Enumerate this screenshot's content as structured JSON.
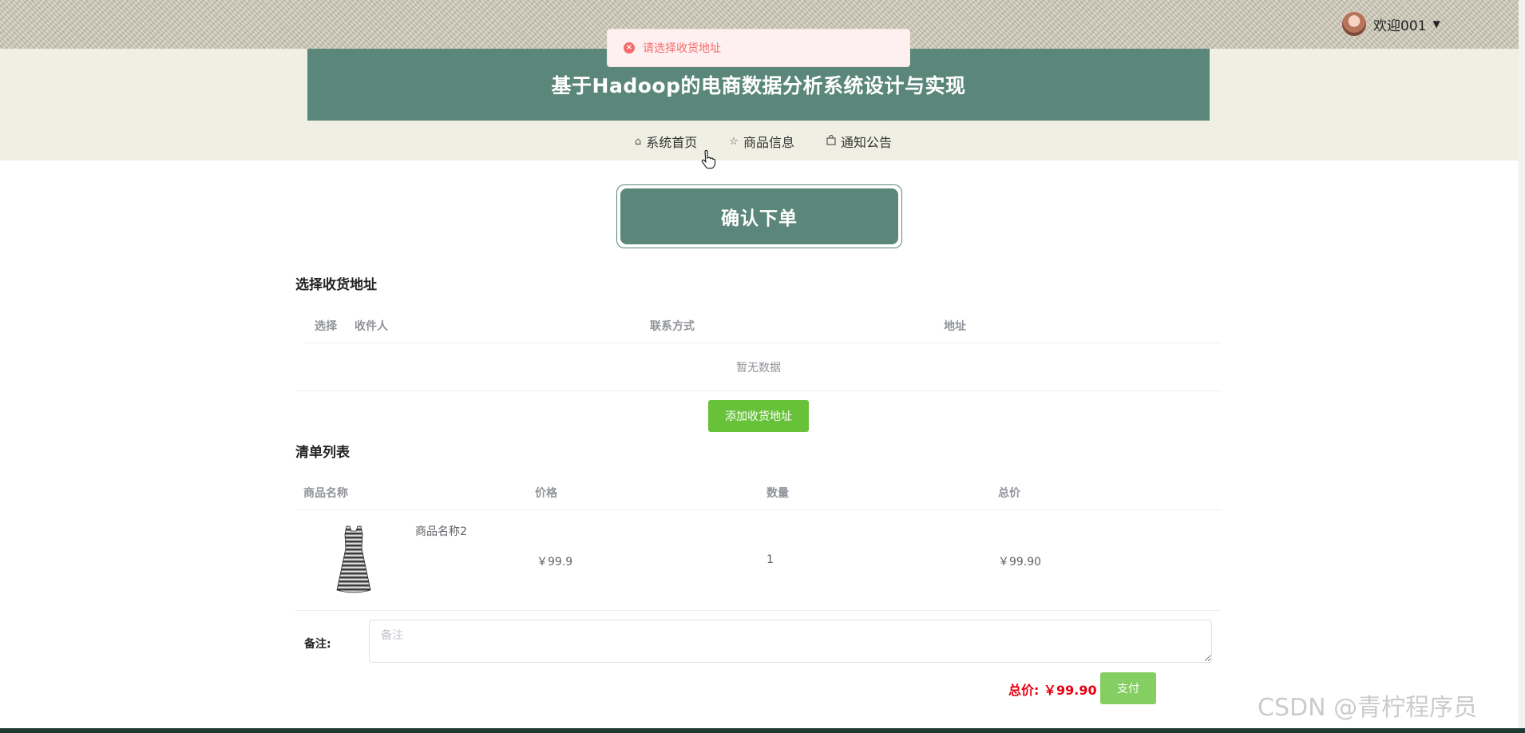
{
  "header": {
    "title": "基于Hadoop的电商数据分析系统设计与实现",
    "user_name": "欢迎001",
    "caret": "▼"
  },
  "nav": {
    "items": [
      {
        "label": "系统首页",
        "icon": "home-icon"
      },
      {
        "label": "商品信息",
        "icon": "star-icon"
      },
      {
        "label": "通知公告",
        "icon": "bag-icon"
      }
    ]
  },
  "toast": {
    "message": "请选择收货地址",
    "type": "error",
    "color": "#f56c6c"
  },
  "banner": {
    "label": "确认下单"
  },
  "address_section": {
    "title": "选择收货地址",
    "columns": [
      "选择",
      "收件人",
      "联系方式",
      "地址"
    ],
    "empty_text": "暂无数据",
    "add_button": "添加收货地址"
  },
  "order_section": {
    "title": "清单列表",
    "columns": [
      "商品名称",
      "价格",
      "数量",
      "总价"
    ],
    "rows": [
      {
        "name": "商品名称2",
        "price": "￥99.9",
        "quantity": "1",
        "total": "￥99.90"
      }
    ]
  },
  "remark": {
    "label": "备注:",
    "placeholder": "备注",
    "value": ""
  },
  "summary": {
    "total_label": "总价:",
    "total_value": "￥99.90",
    "pay_button": "支付"
  },
  "watermark": "CSDN @青柠程序员",
  "colors": {
    "primary": "#5a877a",
    "success": "#67c23a",
    "pay": "#85ce61",
    "price": "#e60012"
  }
}
